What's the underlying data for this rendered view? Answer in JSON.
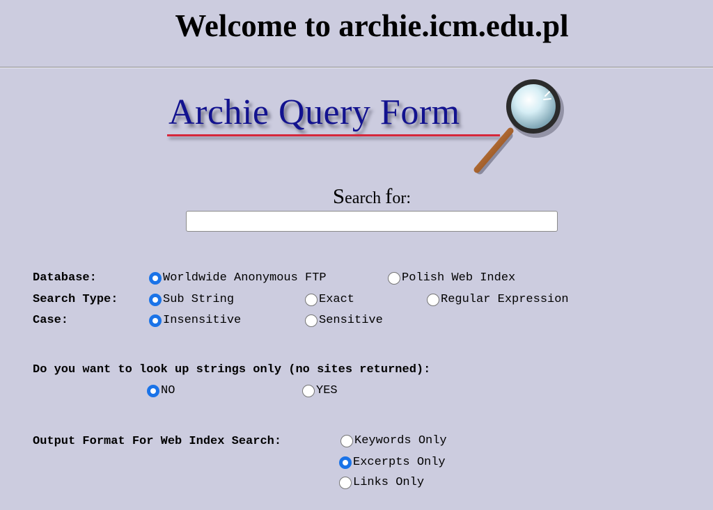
{
  "header": {
    "title": "Welcome to archie.icm.edu.pl"
  },
  "logo": {
    "text": "Archie Query Form",
    "colors": {
      "text": "#12128f",
      "underline": "#d6273b"
    },
    "icon": "magnifying-glass-icon"
  },
  "search": {
    "label_first": "S",
    "label_rest1": "earch ",
    "label_f": "f",
    "label_rest2": "or:",
    "value": "",
    "placeholder": ""
  },
  "database": {
    "label": "Database:",
    "options": [
      {
        "label": "Worldwide Anonymous FTP",
        "selected": true
      },
      {
        "label": "Polish Web Index",
        "selected": false
      }
    ]
  },
  "search_type": {
    "label": "Search Type:",
    "options": [
      {
        "label": "Sub String",
        "selected": true
      },
      {
        "label": "Exact",
        "selected": false
      },
      {
        "label": "Regular Expression",
        "selected": false
      }
    ]
  },
  "case": {
    "label": "Case:",
    "options": [
      {
        "label": "Insensitive",
        "selected": true
      },
      {
        "label": "Sensitive",
        "selected": false
      }
    ]
  },
  "strings_only": {
    "question": "Do you want to look up strings only (no sites returned):",
    "options": [
      {
        "label": "NO",
        "selected": true
      },
      {
        "label": "YES",
        "selected": false
      }
    ]
  },
  "output_format": {
    "label": "Output Format For Web Index Search:",
    "options": [
      {
        "label": "Keywords Only",
        "selected": false
      },
      {
        "label": "Excerpts Only",
        "selected": true
      },
      {
        "label": "Links Only",
        "selected": false
      }
    ]
  },
  "colors": {
    "background": "#ccccdf",
    "radio_accent": "#1a73e8"
  }
}
